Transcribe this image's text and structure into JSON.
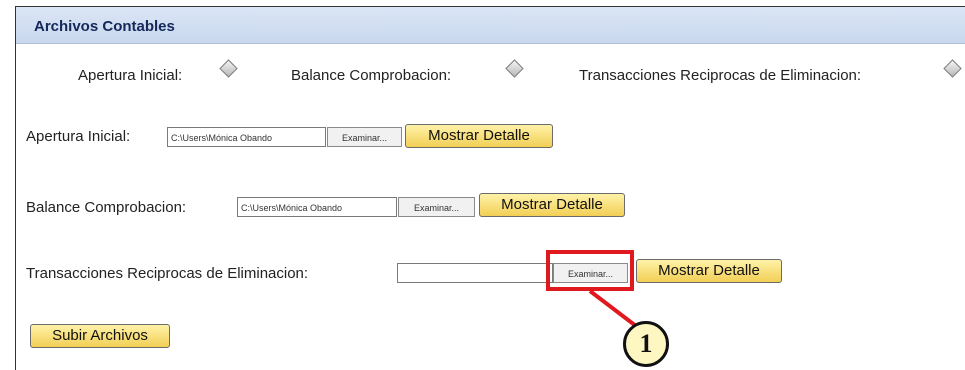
{
  "header": {
    "title": "Archivos Contables"
  },
  "radios": [
    {
      "label": "Apertura Inicial:"
    },
    {
      "label": "Balance Comprobacion:"
    },
    {
      "label": "Transacciones Reciprocas de Eliminacion:"
    }
  ],
  "rows": [
    {
      "label": "Apertura Inicial:",
      "file_value": "C:\\Users\\Mónica Obando",
      "browse_label": "Examinar...",
      "detail_label": "Mostrar Detalle"
    },
    {
      "label": "Balance Comprobacion:",
      "file_value": "C:\\Users\\Mónica Obando",
      "browse_label": "Examinar...",
      "detail_label": "Mostrar Detalle"
    },
    {
      "label": "Transacciones Reciprocas de Eliminacion:",
      "file_value": "",
      "browse_label": "Examinar...",
      "detail_label": "Mostrar Detalle"
    }
  ],
  "actions": {
    "upload_label": "Subir Archivos"
  },
  "callout": {
    "number": "1",
    "color": "#e0191f"
  }
}
